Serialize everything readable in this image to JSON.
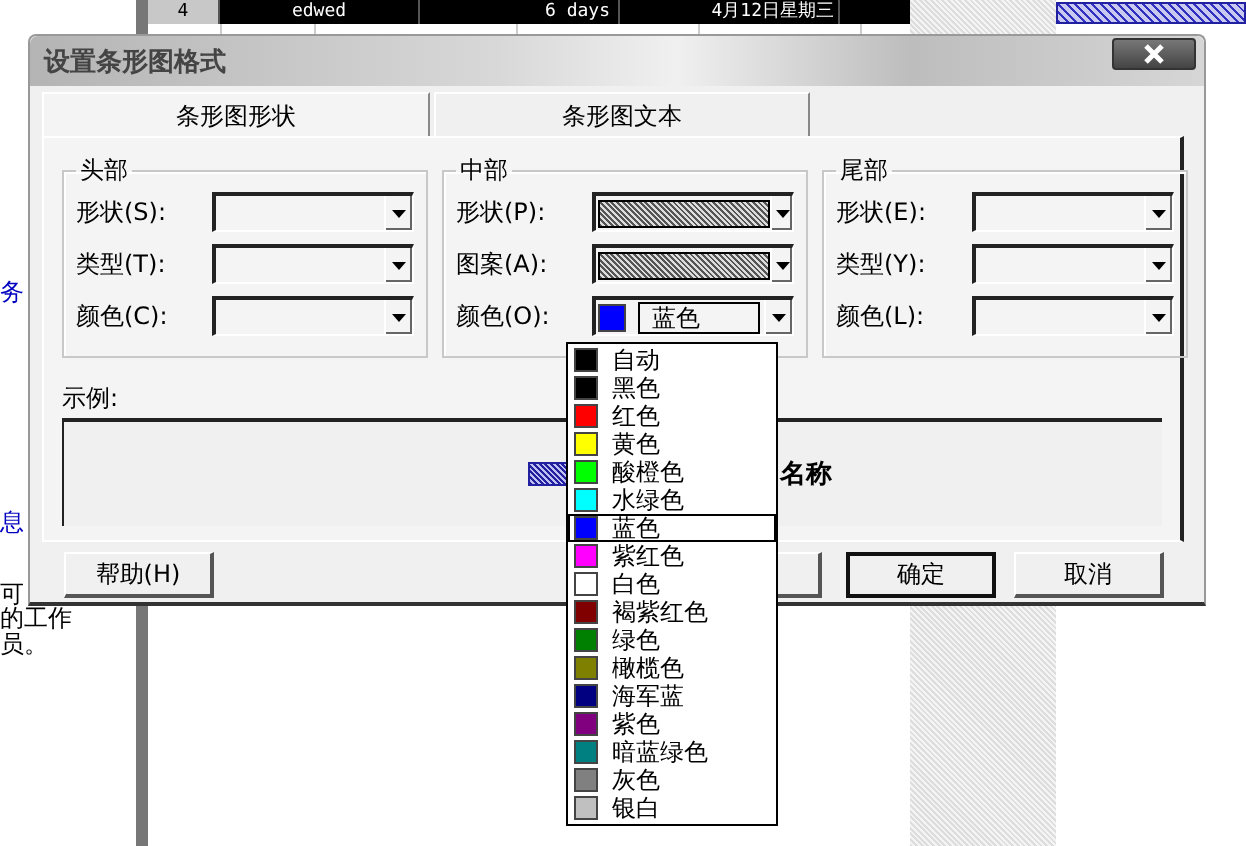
{
  "background": {
    "top_row": [
      "4",
      "edwed",
      "6 days",
      "4月12日星期三"
    ],
    "side_texts": [
      {
        "text": "务",
        "kind": "link"
      },
      {
        "text": "息",
        "kind": "link"
      },
      {
        "text": "可",
        "kind": "plain"
      },
      {
        "text": "的工作",
        "kind": "plain"
      },
      {
        "text": "员。",
        "kind": "plain"
      }
    ]
  },
  "dialog": {
    "title": "设置条形图格式",
    "tabs": [
      {
        "label": "条形图形状",
        "selected": true
      },
      {
        "label": "条形图文本",
        "selected": false
      }
    ],
    "groups": [
      {
        "title": "头部",
        "fields": [
          {
            "label": "形状(S):",
            "kind": "empty"
          },
          {
            "label": "类型(T):",
            "kind": "empty"
          },
          {
            "label": "颜色(C):",
            "kind": "empty"
          }
        ]
      },
      {
        "title": "中部",
        "fields": [
          {
            "label": "形状(P):",
            "kind": "pattern"
          },
          {
            "label": "图案(A):",
            "kind": "pattern"
          },
          {
            "label": "颜色(O):",
            "kind": "color",
            "value": "蓝色",
            "color": "#0000ff"
          }
        ]
      },
      {
        "title": "尾部",
        "fields": [
          {
            "label": "形状(E):",
            "kind": "empty"
          },
          {
            "label": "类型(Y):",
            "kind": "empty"
          },
          {
            "label": "颜色(L):",
            "kind": "empty"
          }
        ]
      }
    ],
    "sample": {
      "label": "示例:",
      "bar_text": "名称"
    },
    "buttons": [
      {
        "label": "帮助(H)",
        "kind": "help"
      },
      {
        "kind": "obscured"
      },
      {
        "label": "确定",
        "kind": "ok"
      },
      {
        "label": "取消",
        "kind": "cancel"
      }
    ],
    "dropdown": {
      "items": [
        {
          "label": "自动",
          "color": "#000000",
          "selected": false
        },
        {
          "label": "黑色",
          "color": "#000000",
          "selected": false
        },
        {
          "label": "红色",
          "color": "#ff0000",
          "selected": false
        },
        {
          "label": "黄色",
          "color": "#ffff00",
          "selected": false
        },
        {
          "label": "酸橙色",
          "color": "#00ff00",
          "selected": false
        },
        {
          "label": "水绿色",
          "color": "#00ffff",
          "selected": false
        },
        {
          "label": "蓝色",
          "color": "#0000ff",
          "selected": true
        },
        {
          "label": "紫红色",
          "color": "#ff00ff",
          "selected": false
        },
        {
          "label": "白色",
          "color": "#ffffff",
          "selected": false
        },
        {
          "label": "褐紫红色",
          "color": "#800000",
          "selected": false
        },
        {
          "label": "绿色",
          "color": "#008000",
          "selected": false
        },
        {
          "label": "橄榄色",
          "color": "#808000",
          "selected": false
        },
        {
          "label": "海军蓝",
          "color": "#000080",
          "selected": false
        },
        {
          "label": "紫色",
          "color": "#800080",
          "selected": false
        },
        {
          "label": "暗蓝绿色",
          "color": "#008080",
          "selected": false
        },
        {
          "label": "灰色",
          "color": "#808080",
          "selected": false
        },
        {
          "label": "银白",
          "color": "#c0c0c0",
          "selected": false
        }
      ]
    }
  }
}
